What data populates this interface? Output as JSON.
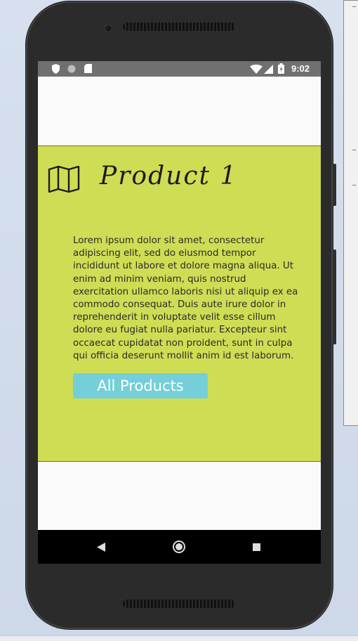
{
  "status_bar": {
    "time": "9:02",
    "icons": [
      "shield-icon",
      "circle-icon",
      "sd-card-icon",
      "wifi-icon",
      "signal-icon",
      "battery-icon"
    ]
  },
  "product": {
    "title": "Product 1",
    "icon": "map-icon",
    "description": "Lorem ipsum dolor sit amet, consectetur adipiscing elit, sed do eiusmod tempor incididunt ut labore et dolore magna aliqua. Ut enim ad minim veniam, quis nostrud exercitation ullamco laboris nisi ut aliquip ex ea commodo consequat. Duis aute irure dolor in reprehenderit in voluptate velit esse cillum dolore eu fugiat nulla pariatur. Excepteur sint occaecat cupidatat non proident, sunt in culpa qui officia deserunt mollit anim id est laborum.",
    "button_label": "All Products"
  },
  "nav_bar": {
    "buttons": [
      "back-icon",
      "home-icon",
      "recents-icon"
    ]
  },
  "colors": {
    "card_background": "#cfdd55",
    "button_background": "#74cfd8",
    "status_bar": "#707070"
  }
}
